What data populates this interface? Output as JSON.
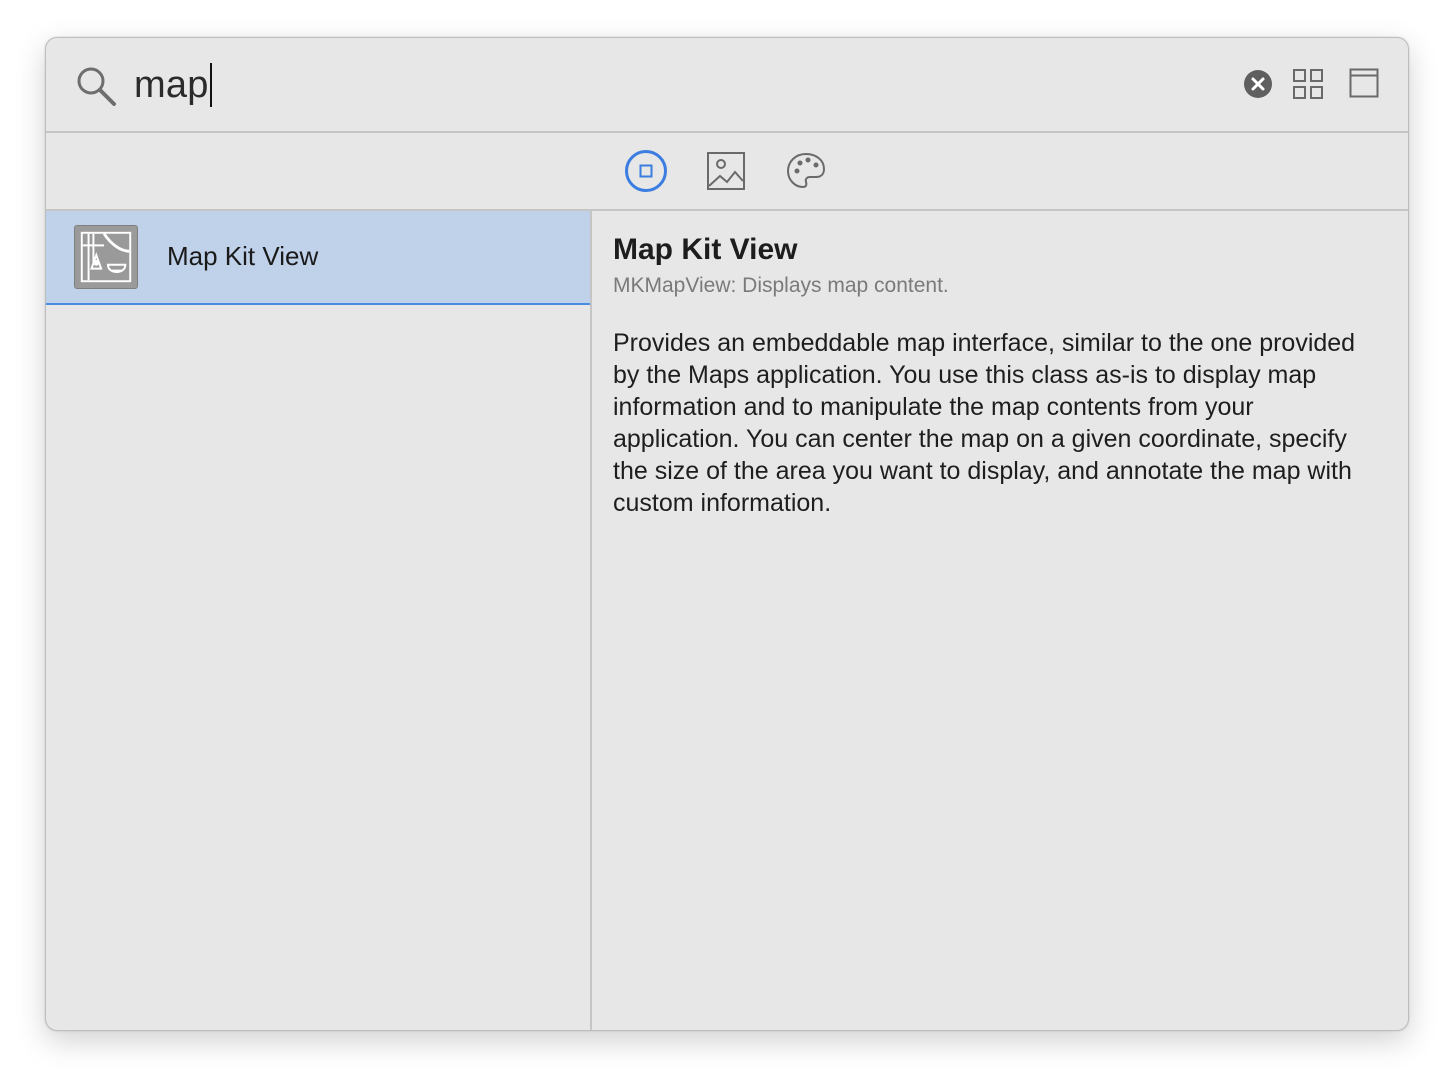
{
  "search": {
    "query": "map"
  },
  "icons": {
    "search": "search-icon",
    "clear": "clear-circle-icon",
    "grid": "grid-view-icon",
    "window": "window-icon",
    "tab_objects": "objects-library-icon",
    "tab_media": "media-library-icon",
    "tab_colors": "color-palette-icon",
    "item_thumb": "map-kit-view-icon"
  },
  "colors": {
    "accent": "#3b7de0",
    "selection": "#c0d1ea",
    "background": "#e6e7e6"
  },
  "results": [
    {
      "label": "Map Kit View"
    }
  ],
  "detail": {
    "title": "Map Kit View",
    "subtitle": "MKMapView: Displays map content.",
    "description": "Provides an embeddable map interface, similar to the one provided by the Maps application. You use this class as-is to display map information and to manipulate the map contents from your application. You can center the map on a given coordinate, specify the size of the area you want to display, and annotate the map with custom information."
  }
}
